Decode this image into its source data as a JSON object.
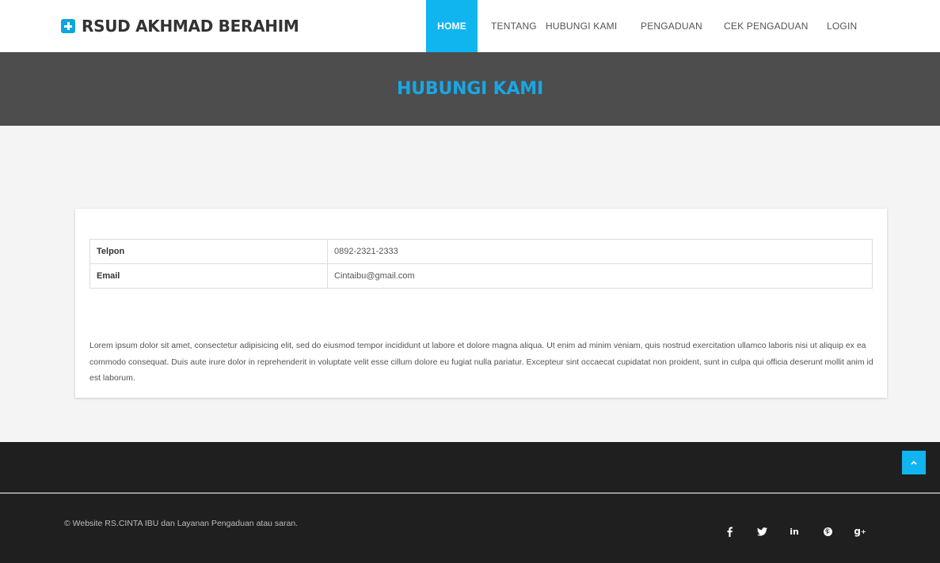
{
  "brand": {
    "name": "RSUD AKHMAD BERAHIM",
    "icon": "plus-square-icon",
    "color": "#10a5e0"
  },
  "nav": {
    "items": [
      {
        "label": "HOME",
        "active": true
      },
      {
        "label": "TENTANG",
        "active": false
      },
      {
        "label": "HUBUNGI KAMI",
        "active": false
      },
      {
        "label": "PENGADUAN",
        "active": false
      },
      {
        "label": "CEK PENGADUAN",
        "active": false
      },
      {
        "label": "LOGIN",
        "active": false
      }
    ],
    "active_color": "#10b5f0"
  },
  "banner": {
    "title": "HUBUNGI KAMI",
    "background": "#4d4d4d",
    "title_color": "#18a7e6"
  },
  "contact": {
    "rows": [
      {
        "label": "Telpon",
        "value": "0892-2321-2333"
      },
      {
        "label": "Email",
        "value": "Cintaibu@gmail.com"
      }
    ],
    "description": "Lorem ipsum dolor sit amet, consectetur adipisicing elit, sed do eiusmod tempor incididunt ut labore et dolore magna aliqua. Ut enim ad minim veniam, quis nostrud exercitation ullamco laboris nisi ut aliquip ex ea commodo consequat. Duis aute irure dolor in reprehenderit in voluptate velit esse cillum dolore eu fugiat nulla pariatur. Excepteur sint occaecat cupidatat non proident, sunt in culpa qui officia deserunt mollit anim id est laborum."
  },
  "footer": {
    "copyright": "© Website RS.CINTA IBU dan Layanan Pengaduan atau saran.",
    "back_to_top_icon": "chevron-up-icon",
    "social": [
      {
        "icon": "facebook-icon",
        "glyph": "f"
      },
      {
        "icon": "twitter-icon",
        "glyph": "t"
      },
      {
        "icon": "linkedin-icon",
        "glyph": "in"
      },
      {
        "icon": "pinterest-icon",
        "glyph": "p"
      },
      {
        "icon": "google-plus-icon",
        "glyph": "g+"
      }
    ]
  }
}
